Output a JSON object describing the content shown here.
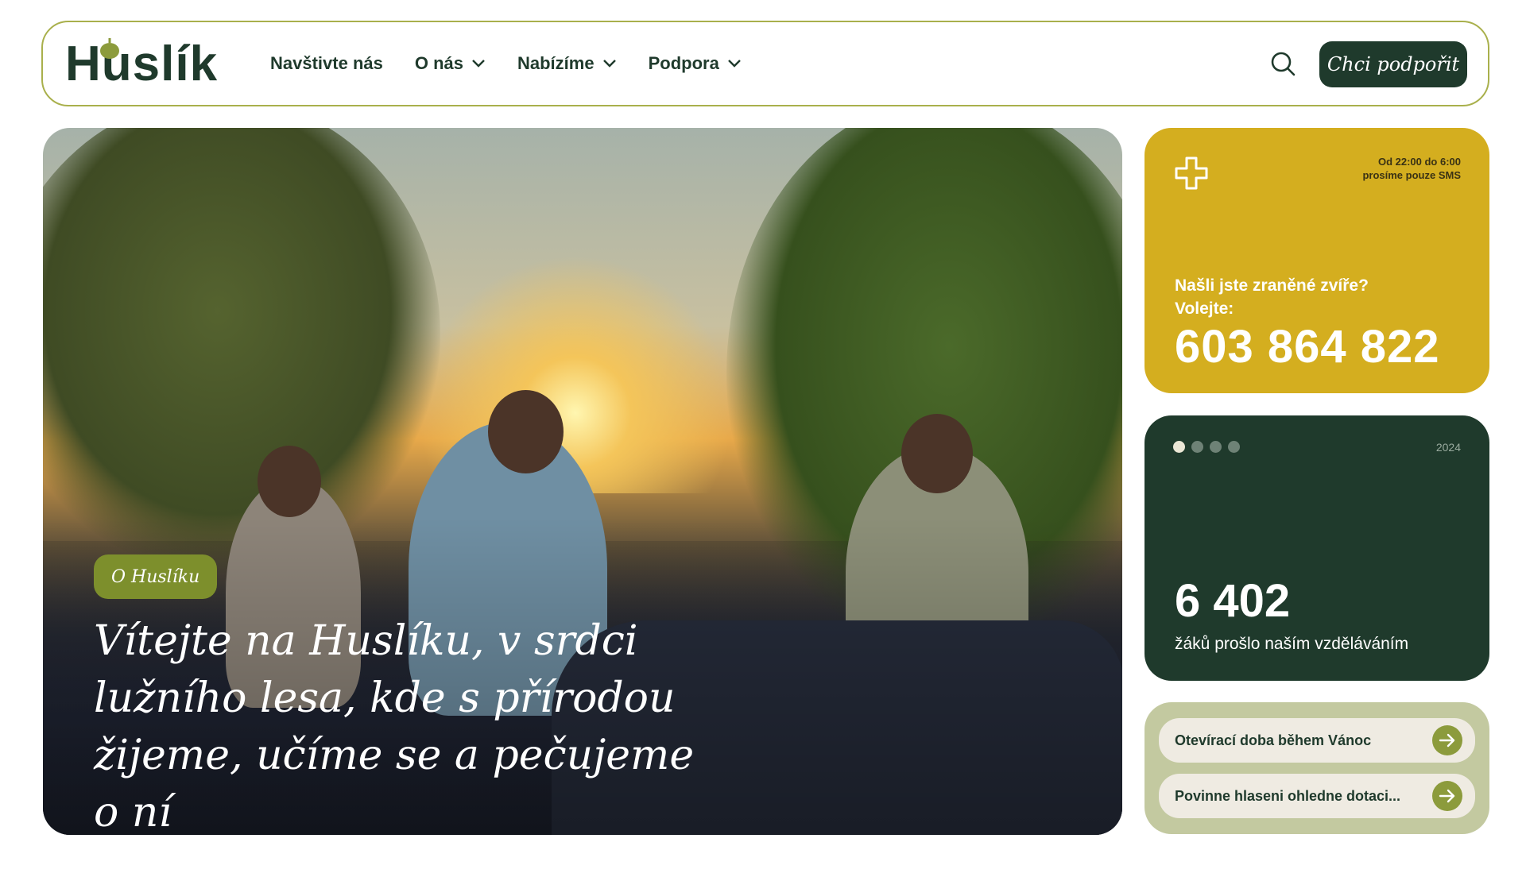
{
  "header": {
    "logo": "Huslík",
    "nav": [
      {
        "label": "Navštivte nás",
        "has_dropdown": false
      },
      {
        "label": "O nás",
        "has_dropdown": true
      },
      {
        "label": "Nabízíme",
        "has_dropdown": true
      },
      {
        "label": "Podpora",
        "has_dropdown": true
      }
    ],
    "cta_label": "Chci podpořit"
  },
  "hero": {
    "tag": "O Huslíku",
    "title": "Vítejte na Huslíku, v srdci lužního lesa, kde s přírodou žijeme, učíme se a pečujeme o ní"
  },
  "emergency": {
    "note_line1": "Od 22:00 do 6:00",
    "note_line2": "prosíme pouze SMS",
    "question": "Našli jste zraněné zvíře?",
    "call": "Volejte:",
    "phone": "603 864 822"
  },
  "stats": {
    "year": "2024",
    "number": "6 402",
    "label": "žáků prošlo naším vzděláváním",
    "active_slide": 1,
    "slides": 4
  },
  "links": [
    {
      "label": "Otevírací doba během Vánoc"
    },
    {
      "label": "Povinne hlaseni ohledne dotaci..."
    }
  ],
  "colors": {
    "brand_dark": "#1f3a2c",
    "accent_olive": "#8c9b3c",
    "accent_yellow": "#d4ae1f",
    "links_bg": "#c3c9a0"
  }
}
